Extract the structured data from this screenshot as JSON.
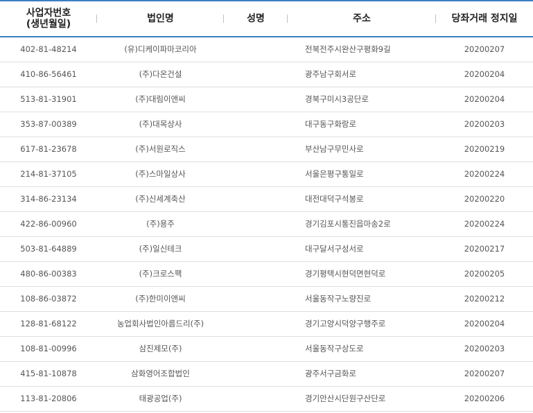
{
  "header": {
    "col_biz_no": "사업자번호\n(생년월일)",
    "col_biz_no_line1": "사업자번호",
    "col_biz_no_line2": "(생년월일)",
    "col_corp_name": "법인명",
    "col_person_name": "성명",
    "col_address": "주소",
    "col_suspend_date": "당좌거래 정지일"
  },
  "rows": [
    {
      "biz_no": "402-81-48214",
      "corp_name": "(유)디케이파마코리아",
      "person_name": "",
      "address": "전북전주시완산구평화9길",
      "date": "20200207"
    },
    {
      "biz_no": "410-86-56461",
      "corp_name": "(주)다온건설",
      "person_name": "",
      "address": "광주남구회서로",
      "date": "20200204"
    },
    {
      "biz_no": "513-81-31901",
      "corp_name": "(주)대림이앤씨",
      "person_name": "",
      "address": "경북구미시3공단로",
      "date": "20200204"
    },
    {
      "biz_no": "353-87-00389",
      "corp_name": "(주)대목상사",
      "person_name": "",
      "address": "대구동구화랑로",
      "date": "20200203"
    },
    {
      "biz_no": "617-81-23678",
      "corp_name": "(주)서원로직스",
      "person_name": "",
      "address": "부산남구무민사로",
      "date": "20200219"
    },
    {
      "biz_no": "214-81-37105",
      "corp_name": "(주)스마일상사",
      "person_name": "",
      "address": "서울은평구통일로",
      "date": "20200224"
    },
    {
      "biz_no": "314-86-23134",
      "corp_name": "(주)신세계축산",
      "person_name": "",
      "address": "대전대덕구석봉로",
      "date": "20200220"
    },
    {
      "biz_no": "422-86-00960",
      "corp_name": "(주)용주",
      "person_name": "",
      "address": "경기김포시통진읍마송2로",
      "date": "20200224"
    },
    {
      "biz_no": "503-81-64889",
      "corp_name": "(주)일신테크",
      "person_name": "",
      "address": "대구달서구성서로",
      "date": "20200217"
    },
    {
      "biz_no": "480-86-00383",
      "corp_name": "(주)크로스팩",
      "person_name": "",
      "address": "경기평택시현덕면현덕로",
      "date": "20200205"
    },
    {
      "biz_no": "108-86-03872",
      "corp_name": "(주)한미이앤씨",
      "person_name": "",
      "address": "서울동작구노량진로",
      "date": "20200212"
    },
    {
      "biz_no": "128-81-68122",
      "corp_name": "농업회사법인아름드리(주)",
      "person_name": "",
      "address": "경기고양시덕양구행주로",
      "date": "20200204"
    },
    {
      "biz_no": "108-81-00996",
      "corp_name": "삼진제모(주)",
      "person_name": "",
      "address": "서울동작구상도로",
      "date": "20200203"
    },
    {
      "biz_no": "415-81-10878",
      "corp_name": "삼화영어조합법인",
      "person_name": "",
      "address": "광주서구금화로",
      "date": "20200207"
    },
    {
      "biz_no": "113-81-20806",
      "corp_name": "태광공업(주)",
      "person_name": "",
      "address": "경기안산시단원구산단로",
      "date": "20200206"
    }
  ],
  "colors": {
    "header_rule": "#3b7fc4",
    "row_rule": "#dedede",
    "text": "#555555"
  }
}
